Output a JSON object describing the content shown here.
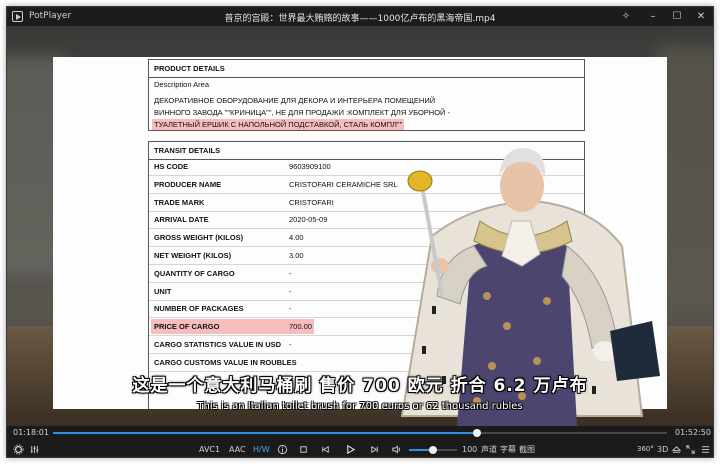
{
  "window": {
    "app_name": "PotPlayer",
    "file_title": "普京的宫殿：世界最大贿赂的故事——1000亿卢布的黑海帝国.mp4"
  },
  "document": {
    "product_details": {
      "header": "PRODUCT DETAILS",
      "description_label": "Description Area",
      "lines": [
        "ДЕКОРАТИВНОЕ ОБОРУДОВАНИЕ ДЛЯ ДЕКОРА И ИНТЕРЬЕРА ПОМЕЩЕНИЙ",
        "ВИННОГО ЗАВОДА \"\"КРИНИЦА\"\", НЕ ДЛЯ ПРОДАЖИ :КОМПЛЕКТ ДЛЯ УБОРНОЙ -",
        "ТУАЛЕТНЫЙ ЕРШИК С НАПОЛЬНОЙ ПОДСТАВКОЙ, СТАЛЬ КОМПЛ\"\""
      ]
    },
    "transit_details": {
      "header": "TRANSIT DETAILS",
      "rows": [
        {
          "label": "HS CODE",
          "value": "9603909100"
        },
        {
          "label": "PRODUCER NAME",
          "value": "CRISTOFARI CERAMICHE SRL"
        },
        {
          "label": "TRADE MARK",
          "value": "CRISTOFARI"
        },
        {
          "label": "ARRIVAL DATE",
          "value": "2020-05-09"
        },
        {
          "label": "GROSS WEIGHT (KILOS)",
          "value": "4.00"
        },
        {
          "label": "NET WEIGHT (KILOS)",
          "value": "3.00"
        },
        {
          "label": "QUANTITY OF CARGO",
          "value": "-"
        },
        {
          "label": "UNIT",
          "value": "-"
        },
        {
          "label": "NUMBER OF PACKAGES",
          "value": "-"
        },
        {
          "label": "PRICE OF CARGO",
          "value": "700.00"
        },
        {
          "label": "CARGO STATISTICS VALUE IN USD",
          "value": "-"
        },
        {
          "label": "CARGO CUSTOMS VALUE IN ROUBLES",
          "value": ""
        }
      ]
    }
  },
  "subtitles": {
    "chinese": "这是一个意大利马桶刷 售价 700 欧元 折合 6.2 万卢布",
    "english": "This is an Italian toilet brush for 700 euros or 62 thousand rubles"
  },
  "playback": {
    "current_time": "01:18:01",
    "total_time": "01:52:50",
    "progress": 0.691
  },
  "controls": {
    "video_codec": "AVC1",
    "audio_codec": "AAC",
    "hw_label": "H/W",
    "volume": 100,
    "volume_level": 0.5,
    "audio_track_label": "声道",
    "subtitle_label": "字幕",
    "screenshot_label": "截图",
    "mode_360": "360°",
    "mode_3d": "3D"
  },
  "colors": {
    "accent": "#2f8fe0",
    "highlight": "#f7bcbc"
  }
}
